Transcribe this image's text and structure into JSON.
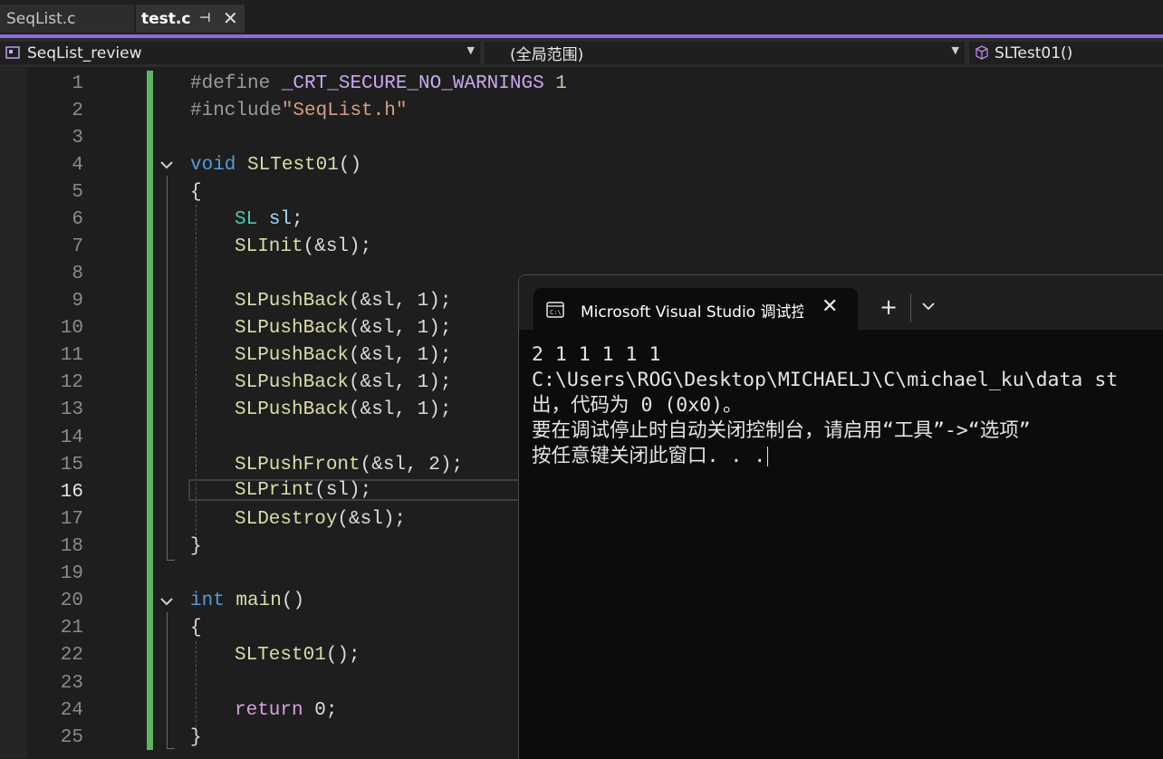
{
  "tabs": [
    {
      "label": "SeqList.c",
      "active": false
    },
    {
      "label": "test.c",
      "active": true,
      "pin_icon": "pin-icon",
      "close_icon": "close-icon"
    }
  ],
  "navbar": {
    "project": "SeqList_review",
    "scope": "(全局范围)",
    "function": "SLTest01()"
  },
  "editor": {
    "current_line": 16,
    "line_numbers": [
      "1",
      "2",
      "3",
      "4",
      "5",
      "6",
      "7",
      "8",
      "9",
      "10",
      "11",
      "12",
      "13",
      "14",
      "15",
      "16",
      "17",
      "18",
      "19",
      "20",
      "21",
      "22",
      "23",
      "24",
      "25"
    ],
    "code": {
      "l1_directive": "#define ",
      "l1_macro": "_CRT_SECURE_NO_WARNINGS",
      "l1_value": " 1",
      "l2_directive": "#include",
      "l2_file": "\"SeqList.h\"",
      "l4_kw": "void",
      "l4_fn": "SLTest01",
      "l4_rest": "()",
      "brace_open": "{",
      "brace_close": "}",
      "l6_type": "SL",
      "l6_var": "sl",
      "l6_end": ";",
      "l7_fn": "SLInit",
      "l7_rest": "(&sl);",
      "push_fn": "SLPushBack",
      "push_rest": "(&sl, 1);",
      "l15_fn": "SLPushFront",
      "l15_rest": "(&sl, 2);",
      "l16_fn": "SLPrint",
      "l16_rest": "(sl);",
      "l17_fn": "SLDestroy",
      "l17_rest": "(&sl);",
      "l20_kw": "int",
      "l20_fn": "main",
      "l20_rest": "()",
      "l22_fn": "SLTest01",
      "l22_rest": "();",
      "l24_kw": "return",
      "l24_rest": " 0;"
    }
  },
  "console": {
    "tab_title": "Microsoft Visual Studio 调试控",
    "lines": [
      "2 1 1 1 1 1",
      "C:\\Users\\ROG\\Desktop\\MICHAELJ\\C\\michael_ku\\data st",
      "出，代码为 0 (0x0)。",
      "要在调试停止时自动关闭控制台，请启用“工具”->“选项”",
      "按任意键关闭此窗口. . ."
    ]
  },
  "colors": {
    "accent": "#8e6bd8",
    "changed_bar": "#5fb55f",
    "keyword": "#569cd6",
    "function": "#dcdcaa",
    "type": "#4ec9b0",
    "variable": "#9cdcfe"
  }
}
